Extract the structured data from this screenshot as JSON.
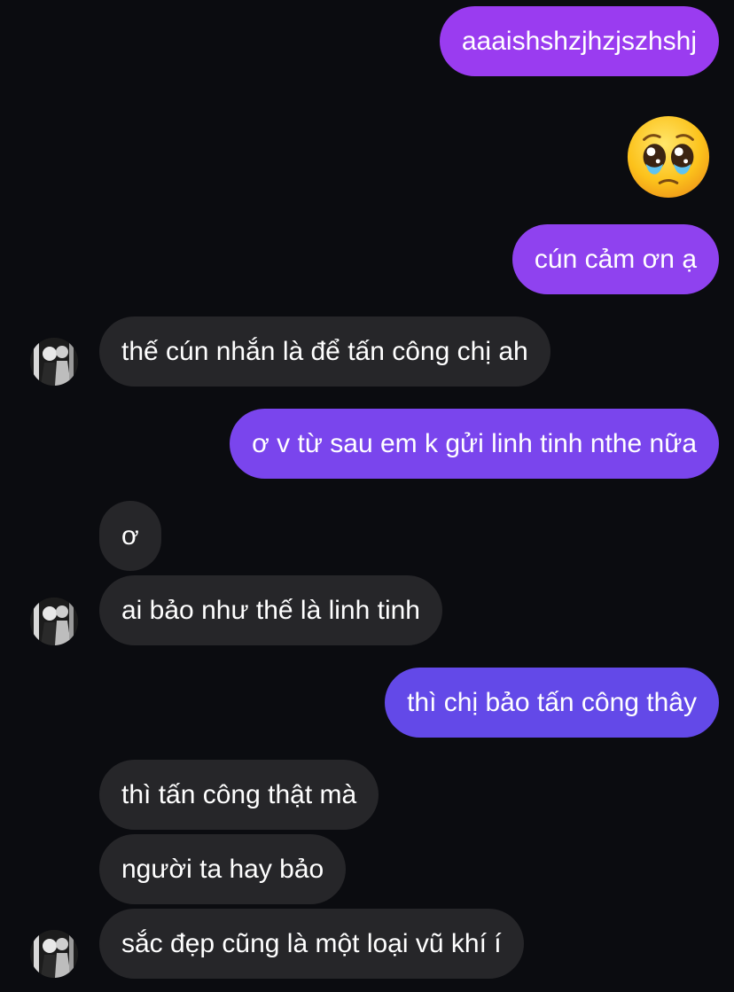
{
  "messages": [
    {
      "side": "out",
      "text": "aaaishshzjhzjszhshj"
    },
    {
      "side": "out",
      "emoji": "pleading-face"
    },
    {
      "side": "out",
      "text": "cún cảm ơn ạ"
    },
    {
      "side": "in",
      "text": "thế cún nhắn là để tấn công chị ah"
    },
    {
      "side": "out",
      "text": "ơ v từ sau em k gửi linh tinh nthe nữa"
    },
    {
      "side": "in",
      "text": "ơ"
    },
    {
      "side": "in",
      "text": "ai bảo như thế là linh tinh"
    },
    {
      "side": "out",
      "text": "thì chị bảo tấn công thây"
    },
    {
      "side": "in",
      "text": "thì tấn công thật mà"
    },
    {
      "side": "in",
      "text": "người ta hay bảo"
    },
    {
      "side": "in",
      "text": "sắc đẹp cũng là một loại vũ khí í"
    }
  ],
  "colors": {
    "background": "#0b0c10",
    "incoming_bubble": "#262629",
    "outgoing_gradient_top": "#9a3cf0",
    "outgoing_gradient_bottom": "#5a4ae6",
    "text": "#ffffff"
  }
}
